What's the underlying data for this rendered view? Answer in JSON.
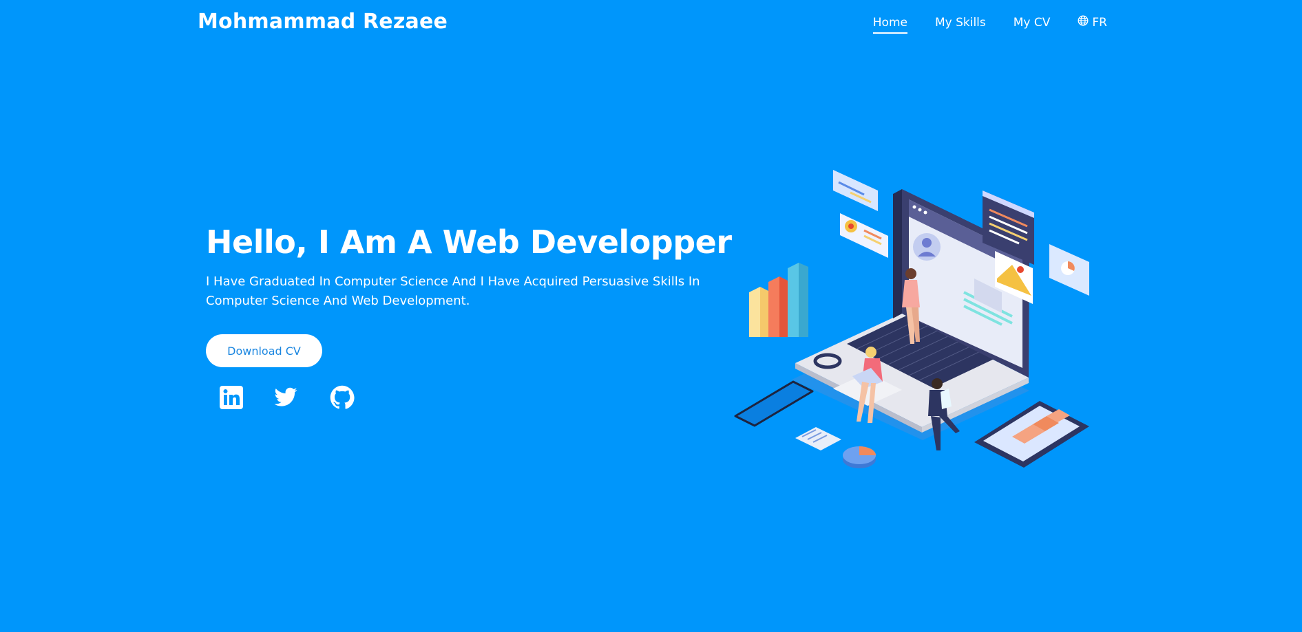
{
  "header": {
    "brand": "Mohmammad Rezaee",
    "nav": [
      {
        "label": "Home",
        "active": true
      },
      {
        "label": "My Skills",
        "active": false
      },
      {
        "label": "My CV",
        "active": false
      }
    ],
    "language": {
      "label": "FR",
      "icon": "globe-icon"
    }
  },
  "hero": {
    "title": "Hello, I Am A Web Developper",
    "description": "I Have Graduated In Computer Science And I Have Acquired Persuasive Skills In Computer Science And Web Development.",
    "download_label": "Download CV",
    "social": [
      {
        "icon": "linkedin-icon"
      },
      {
        "icon": "twitter-icon"
      },
      {
        "icon": "github-icon"
      }
    ],
    "illustration": "isometric-laptop-illustration"
  },
  "colors": {
    "background": "#0096fb",
    "button_text": "#1a86e0",
    "text": "#ffffff"
  }
}
